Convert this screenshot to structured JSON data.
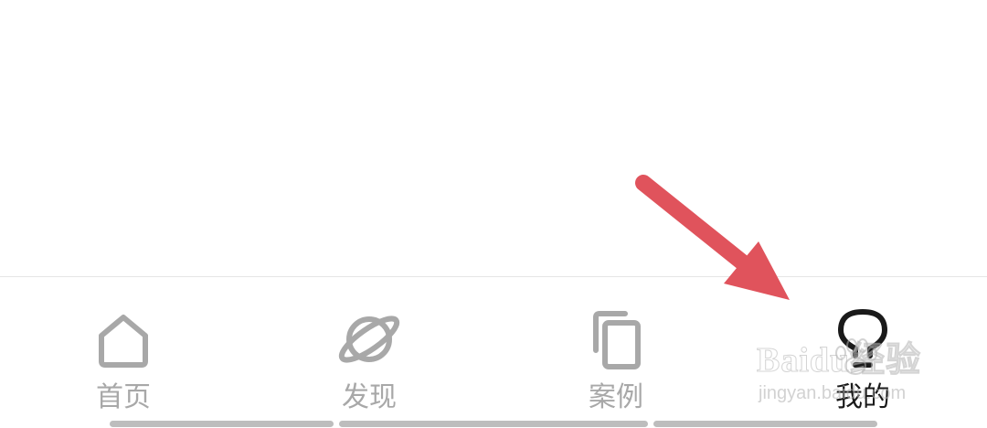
{
  "tab_bar": {
    "tabs": [
      {
        "label": "首页",
        "icon": "home-icon",
        "active": false
      },
      {
        "label": "发现",
        "icon": "planet-icon",
        "active": false
      },
      {
        "label": "案例",
        "icon": "copy-icon",
        "active": false
      },
      {
        "label": "我的",
        "icon": "lightbulb-icon",
        "active": true
      }
    ]
  },
  "annotation": {
    "arrow_color": "#e0535c"
  },
  "watermark": {
    "brand": "Baidu经验",
    "domain": "jingyan.baidu.com"
  },
  "colors": {
    "inactive": "#a8a8a8",
    "active": "#1a1a1a",
    "indicator": "#bdbdbd"
  }
}
